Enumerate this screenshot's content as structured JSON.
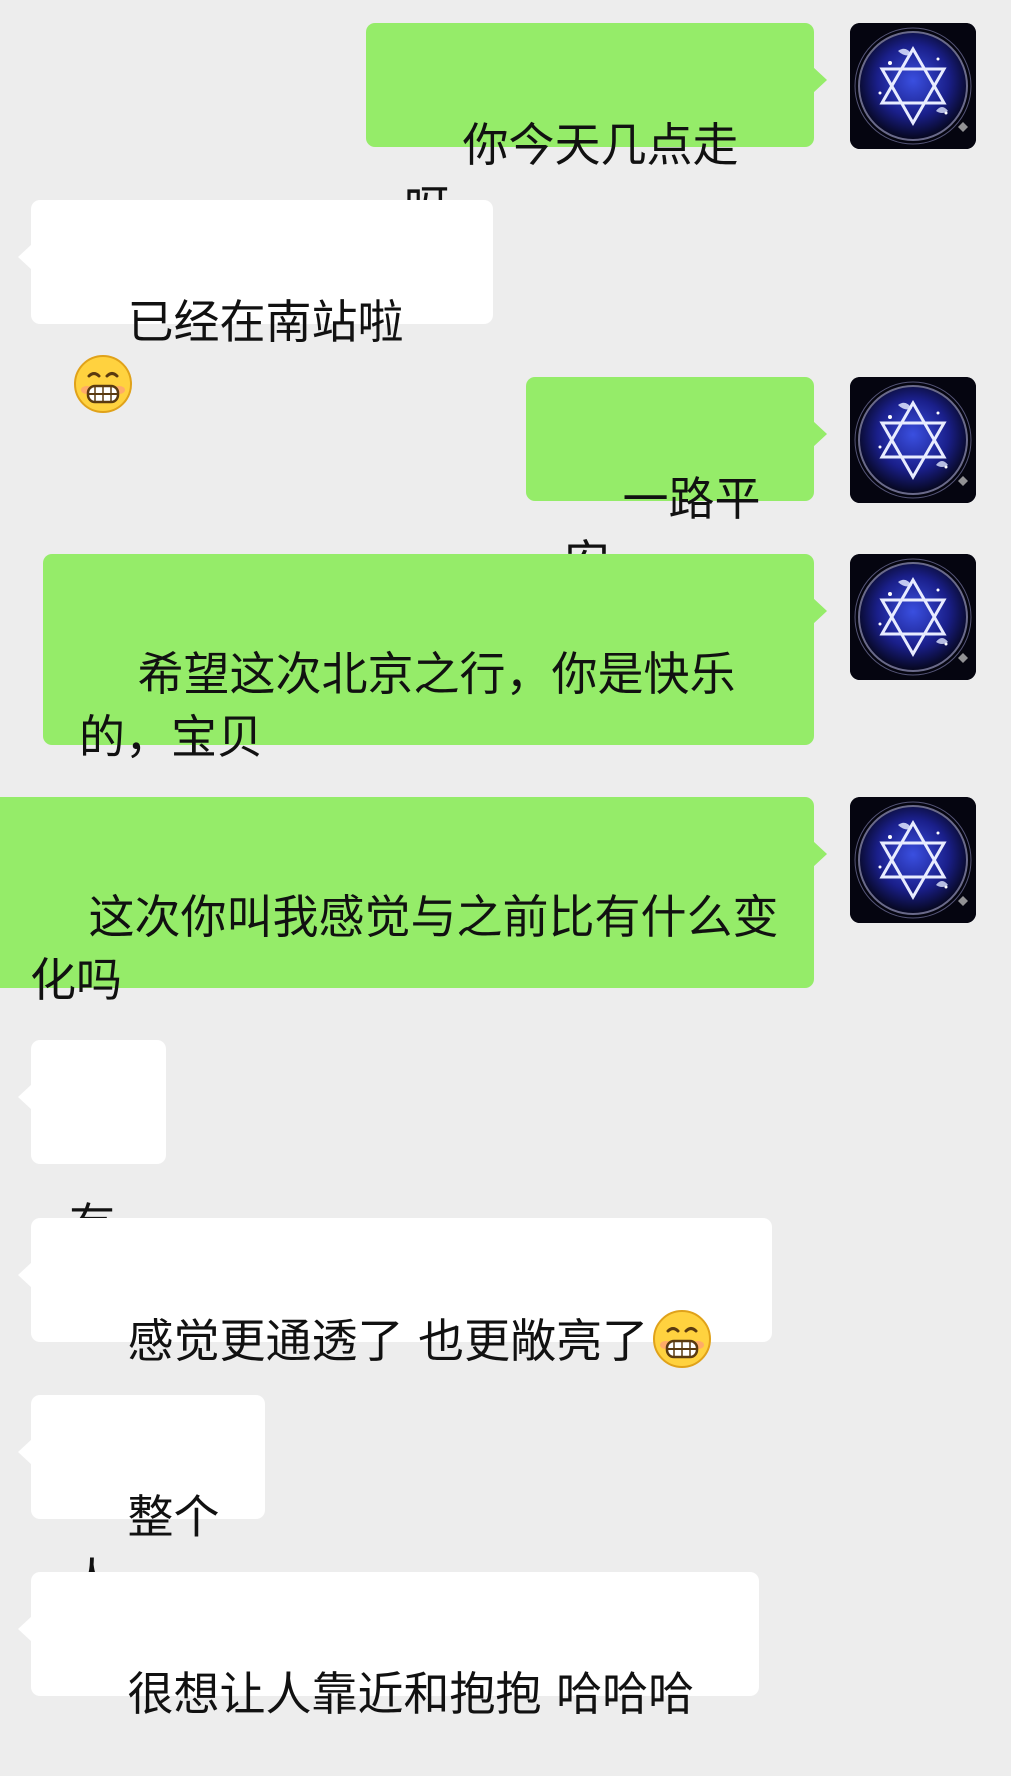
{
  "messages": [
    {
      "side": "sent",
      "text": "你今天几点走呀"
    },
    {
      "side": "received",
      "text": "已经在南站啦",
      "emoji": "grinning-face-emoji"
    },
    {
      "side": "sent",
      "text": "一路平安"
    },
    {
      "side": "sent",
      "text": "希望这次北京之行，你是快乐的，宝贝"
    },
    {
      "side": "sent",
      "text": "这次你叫我感觉与之前比有什么变化吗"
    },
    {
      "side": "received",
      "text": "有"
    },
    {
      "side": "received",
      "text": "感觉更通透了 也更敞亮了",
      "emoji": "grinning-face-emoji"
    },
    {
      "side": "received",
      "text": "整个人"
    },
    {
      "side": "received",
      "text": "很想让人靠近和抱抱 哈哈哈"
    }
  ],
  "avatar_icon": "star-of-david-avatar-icon",
  "colors": {
    "background": "#ededed",
    "sent_bubble": "#95ec69",
    "received_bubble": "#ffffff",
    "text": "#111111"
  }
}
